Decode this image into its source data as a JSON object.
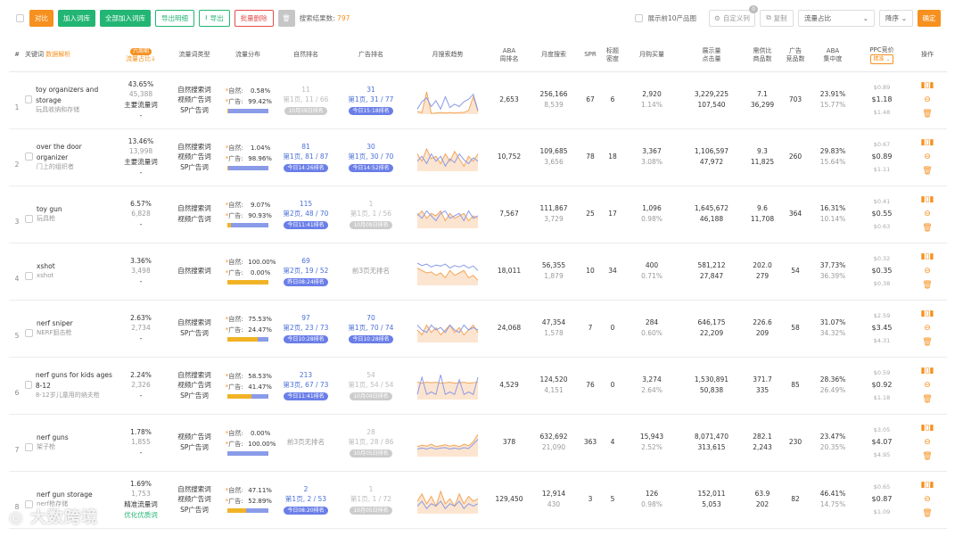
{
  "toolbar": {
    "compare": "对比",
    "add_lib": "加入词库",
    "add_all": "全部加入词库",
    "export_detail": "导出明细",
    "export": "导出",
    "batch_delete": "批量删除",
    "result_label": "搜索结果数:",
    "result_count": "797",
    "show_top10": "展示前10产品图",
    "custom_col": "自定义列",
    "custom_badge": "0",
    "copy": "复制",
    "sort_field": "流量占比",
    "sort_order": "降序",
    "confirm": "确定"
  },
  "headers": {
    "idx": "#",
    "keyword": "关键词",
    "keyword_tag": "数据解析",
    "share_badge": "六周期",
    "share": "流量占比",
    "type": "流量词类型",
    "dist": "流量分布",
    "organic": "自然排名",
    "ad": "广告排名",
    "trend": "月搜索趋势",
    "aba1": "ABA",
    "aba2": "周排名",
    "monthly": "月度搜索",
    "spr": "SPR",
    "title_density1": "标题",
    "title_density2": "密度",
    "monthly_buy": "月购买量",
    "impr1": "展示量",
    "impr2": "点击量",
    "supply1": "需供比",
    "supply2": "商品数",
    "ad_prod1": "广告",
    "ad_prod2": "竞品数",
    "aba_conc1": "ABA",
    "aba_conc2": "集中度",
    "ppc": "PPC竞价",
    "ppc_sel": "精准",
    "ops": "操作"
  },
  "rows": [
    {
      "idx": "1",
      "kw": "toy organizers and storage",
      "kw_cn": "玩具收纳和存储",
      "share": "43.65%",
      "share2": "45,388",
      "note": "主要流量词",
      "note_green": "",
      "dash": "-",
      "types": [
        "自然搜索词",
        "视频广告词",
        "SP广告词"
      ],
      "org_pct": "0.58%",
      "ad_pct": "99.42%",
      "org_share": 0.0058,
      "org_main": "11",
      "org_sub": "第1页, 11 / 66",
      "org_tag": "10月09日排名",
      "org_tag_gray": true,
      "ad_main": "31",
      "ad_sub": "第1页, 31 / 77",
      "ad_tag": "今日15:18排名",
      "ad_tag_gray": false,
      "aba": "2,653",
      "monthly": "256,166",
      "monthly2": "8,539",
      "spr": "67",
      "density": "6",
      "buy": "2,920",
      "buy2": "1.14%",
      "impr": "3,229,225",
      "click": "107,540",
      "ratio": "7.1",
      "goods": "36,299",
      "ad_goods": "703",
      "conc": "23.91%",
      "conc2": "15.77%",
      "ppc_low": "$0.89",
      "ppc_mid": "$1.18",
      "ppc_high": "$1.48",
      "trend_a": [
        60,
        62,
        20,
        64,
        63,
        62,
        63,
        62,
        63,
        62,
        62,
        58,
        30,
        60
      ],
      "trend_b": [
        55,
        40,
        32,
        50,
        38,
        55,
        30,
        52,
        45,
        50,
        40,
        35,
        25,
        58
      ]
    },
    {
      "idx": "2",
      "kw": "over the door organizer",
      "kw_cn": "门上的组织者",
      "share": "13.46%",
      "share2": "13,998",
      "note": "主要流量词",
      "note_green": "",
      "dash": "-",
      "types": [
        "自然搜索词",
        "视频广告词",
        "SP广告词"
      ],
      "org_pct": "1.04%",
      "ad_pct": "98.96%",
      "org_share": 0.0104,
      "org_main": "81",
      "org_sub": "第1页, 81 / 87",
      "org_tag": "今日14:26排名",
      "org_tag_gray": false,
      "ad_main": "30",
      "ad_sub": "第1页, 30 / 70",
      "ad_tag": "今日14:52排名",
      "ad_tag_gray": false,
      "aba": "10,752",
      "monthly": "109,685",
      "monthly2": "3,656",
      "spr": "78",
      "density": "18",
      "buy": "3,367",
      "buy2": "3.08%",
      "impr": "1,106,597",
      "click": "47,972",
      "ratio": "9.3",
      "goods": "11,825",
      "ad_goods": "260",
      "conc": "29.83%",
      "conc2": "15.64%",
      "ppc_low": "$0.67",
      "ppc_mid": "$0.89",
      "ppc_high": "$1.11",
      "trend_a": [
        30,
        45,
        20,
        40,
        35,
        50,
        30,
        45,
        25,
        40,
        55,
        35,
        45,
        30
      ],
      "trend_b": [
        45,
        35,
        50,
        30,
        45,
        35,
        55,
        40,
        48,
        30,
        42,
        50,
        38,
        45
      ]
    },
    {
      "idx": "3",
      "kw": "toy gun",
      "kw_cn": "玩具枪",
      "share": "6.57%",
      "share2": "6,828",
      "note": "-",
      "note_green": "",
      "dash": "",
      "types": [
        "自然搜索词",
        "视频广告词"
      ],
      "org_pct": "9.07%",
      "ad_pct": "90.93%",
      "org_share": 0.0907,
      "org_main": "115",
      "org_sub": "第2页, 48 / 70",
      "org_tag": "今日11:41排名",
      "org_tag_gray": false,
      "ad_main": "1",
      "ad_sub": "第1页, 1 / 56",
      "ad_tag": "10月09日排名",
      "ad_tag_gray": true,
      "aba": "7,567",
      "monthly": "111,867",
      "monthly2": "3,729",
      "spr": "25",
      "density": "17",
      "buy": "1,096",
      "buy2": "0.98%",
      "impr": "1,645,672",
      "click": "46,188",
      "ratio": "9.6",
      "goods": "11,708",
      "ad_goods": "364",
      "conc": "16.31%",
      "conc2": "10.14%",
      "ppc_low": "$0.41",
      "ppc_mid": "$0.55",
      "ppc_high": "$0.63",
      "trend_a": [
        40,
        30,
        45,
        35,
        40,
        30,
        50,
        35,
        45,
        40,
        35,
        50,
        40,
        45
      ],
      "trend_b": [
        35,
        45,
        30,
        40,
        50,
        35,
        30,
        45,
        40,
        35,
        50,
        30,
        45,
        40
      ]
    },
    {
      "idx": "4",
      "kw": "xshot",
      "kw_cn": "xshot",
      "share": "3.36%",
      "share2": "3,498",
      "note": "-",
      "note_green": "",
      "dash": "",
      "types": [
        "自然搜索词"
      ],
      "org_pct": "100.00%",
      "ad_pct": "0.00%",
      "org_share": 1.0,
      "org_main": "69",
      "org_sub": "第2页, 19 / 52",
      "org_tag": "昨日08:24排名",
      "org_tag_gray": false,
      "ad_main": "",
      "ad_sub": "前3页无排名",
      "ad_tag": "",
      "ad_tag_gray": true,
      "aba": "18,011",
      "monthly": "56,355",
      "monthly2": "1,879",
      "spr": "10",
      "density": "34",
      "buy": "400",
      "buy2": "0.71%",
      "impr": "581,212",
      "click": "27,847",
      "ratio": "202.0",
      "goods": "279",
      "ad_goods": "54",
      "conc": "37.73%",
      "conc2": "36.39%",
      "ppc_low": "$0.32",
      "ppc_mid": "$0.35",
      "ppc_high": "$0.38",
      "trend_a": [
        30,
        35,
        40,
        38,
        45,
        40,
        50,
        35,
        45,
        40,
        35,
        50,
        45,
        55
      ],
      "trend_b": [
        20,
        25,
        22,
        28,
        24,
        26,
        22,
        30,
        25,
        28,
        24,
        30,
        26,
        35
      ]
    },
    {
      "idx": "5",
      "kw": "nerf sniper",
      "kw_cn": "NERF狙击枪",
      "share": "2.63%",
      "share2": "2,734",
      "note": "-",
      "note_green": "",
      "dash": "",
      "types": [
        "自然搜索词",
        "SP广告词"
      ],
      "org_pct": "75.53%",
      "ad_pct": "24.47%",
      "org_share": 0.7553,
      "org_main": "97",
      "org_sub": "第2页, 23 / 73",
      "org_tag": "今日10:28排名",
      "org_tag_gray": false,
      "ad_main": "70",
      "ad_sub": "第1页, 70 / 74",
      "ad_tag": "今日10:28排名",
      "ad_tag_gray": false,
      "aba": "24,068",
      "monthly": "47,354",
      "monthly2": "1,578",
      "spr": "7",
      "density": "0",
      "buy": "284",
      "buy2": "0.60%",
      "impr": "646,175",
      "click": "22,209",
      "ratio": "226.6",
      "goods": "209",
      "ad_goods": "58",
      "conc": "31.07%",
      "conc2": "34.32%",
      "ppc_low": "$2.59",
      "ppc_mid": "$3.45",
      "ppc_high": "$4.31",
      "trend_a": [
        40,
        50,
        30,
        45,
        35,
        50,
        40,
        30,
        45,
        35,
        50,
        40,
        30,
        45
      ],
      "trend_b": [
        30,
        40,
        45,
        30,
        40,
        35,
        45,
        30,
        40,
        45,
        30,
        40,
        35,
        40
      ]
    },
    {
      "idx": "6",
      "kw": "nerf guns for kids ages 8-12",
      "kw_cn": "8-12岁儿童用的纳夫枪",
      "share": "2.24%",
      "share2": "2,326",
      "note": "-",
      "note_green": "",
      "dash": "",
      "types": [
        "自然搜索词",
        "视频广告词",
        "SP广告词"
      ],
      "org_pct": "58.53%",
      "ad_pct": "41.47%",
      "org_share": 0.5853,
      "org_main": "213",
      "org_sub": "第3页, 67 / 73",
      "org_tag": "今日11:41排名",
      "org_tag_gray": false,
      "ad_main": "54",
      "ad_sub": "第1页, 54 / 54",
      "ad_tag": "10月09日排名",
      "ad_tag_gray": true,
      "aba": "4,529",
      "monthly": "124,520",
      "monthly2": "4,151",
      "spr": "76",
      "density": "0",
      "buy": "3,274",
      "buy2": "2.64%",
      "impr": "1,530,891",
      "click": "50,838",
      "ratio": "371.7",
      "goods": "335",
      "ad_goods": "85",
      "conc": "28.36%",
      "conc2": "26.49%",
      "ppc_low": "$0.59",
      "ppc_mid": "$0.92",
      "ppc_high": "$1.18",
      "trend_a": [
        30,
        32,
        30,
        31,
        30,
        32,
        31,
        30,
        32,
        31,
        30,
        32,
        31,
        30
      ],
      "trend_b": [
        55,
        20,
        55,
        50,
        55,
        15,
        55,
        50,
        55,
        25,
        55,
        50,
        55,
        20
      ]
    },
    {
      "idx": "7",
      "kw": "nerf guns",
      "kw_cn": "架子枪",
      "share": "1.78%",
      "share2": "1,855",
      "note": "-",
      "note_green": "",
      "dash": "",
      "types": [
        "视频广告词",
        "SP广告词"
      ],
      "org_pct": "0.00%",
      "ad_pct": "100.00%",
      "org_share": 0.0,
      "org_main": "",
      "org_sub": "前3页无排名",
      "org_tag": "",
      "org_tag_gray": true,
      "ad_main": "28",
      "ad_sub": "第1页, 28 / 86",
      "ad_tag": "10月05日排名",
      "ad_tag_gray": true,
      "aba": "378",
      "monthly": "632,692",
      "monthly2": "21,090",
      "spr": "363",
      "density": "4",
      "buy": "15,943",
      "buy2": "2.52%",
      "impr": "8,071,470",
      "click": "313,615",
      "ratio": "282.1",
      "goods": "2,243",
      "ad_goods": "230",
      "conc": "23.47%",
      "conc2": "20.35%",
      "ppc_low": "$3.05",
      "ppc_mid": "$4.07",
      "ppc_high": "$4.95",
      "trend_a": [
        45,
        42,
        44,
        40,
        45,
        43,
        41,
        44,
        42,
        45,
        40,
        43,
        35,
        20
      ],
      "trend_b": [
        50,
        48,
        50,
        47,
        50,
        48,
        47,
        50,
        48,
        50,
        47,
        49,
        40,
        30
      ]
    },
    {
      "idx": "8",
      "kw": "nerf gun storage",
      "kw_cn": "nerf枪存储",
      "share": "1.69%",
      "share2": "1,753",
      "note": "精准流量词",
      "note_green": "优化优质词",
      "dash": "",
      "types": [
        "自然搜索词",
        "视频广告词",
        "SP广告词"
      ],
      "org_pct": "47.11%",
      "ad_pct": "52.89%",
      "org_share": 0.4711,
      "org_main": "2",
      "org_sub": "第1页, 2 / 53",
      "org_tag": "今日08:20排名",
      "org_tag_gray": false,
      "ad_main": "1",
      "ad_sub": "第1页, 1 / 72",
      "ad_tag": "10月05日排名",
      "ad_tag_gray": true,
      "aba": "129,450",
      "monthly": "12,914",
      "monthly2": "430",
      "spr": "3",
      "density": "5",
      "buy": "126",
      "buy2": "0.98%",
      "impr": "152,011",
      "click": "5,053",
      "ratio": "63.9",
      "goods": "202",
      "ad_goods": "82",
      "conc": "46.41%",
      "conc2": "14.75%",
      "ppc_low": "$0.65",
      "ppc_mid": "$0.87",
      "ppc_high": "$1.09",
      "trend_a": [
        40,
        25,
        45,
        30,
        50,
        20,
        45,
        35,
        50,
        25,
        45,
        30,
        40,
        35
      ],
      "trend_b": [
        50,
        40,
        55,
        45,
        50,
        40,
        55,
        45,
        50,
        40,
        55,
        45,
        50,
        45
      ]
    }
  ],
  "icons": {
    "chart": "bar-chart-icon",
    "minus": "minus-circle-icon",
    "trash": "trash-icon"
  },
  "watermark": "大数跨境",
  "colors": {
    "orange": "#f6901e",
    "green": "#22b573",
    "blue": "#4a6fd8",
    "purple": "#8a9be8",
    "amber": "#f1b325"
  }
}
